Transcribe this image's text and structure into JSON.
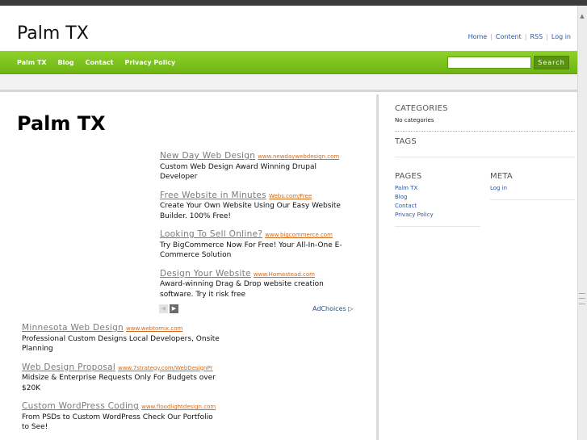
{
  "site": {
    "title": "Palm TX"
  },
  "toplinks": [
    "Home",
    "Content",
    "RSS",
    "Log in"
  ],
  "nav": [
    "Palm TX",
    "Blog",
    "Contact",
    "Privacy Policy"
  ],
  "search": {
    "button_label": "Search",
    "placeholder": ""
  },
  "page": {
    "title": "Palm TX"
  },
  "ads_primary": [
    {
      "title": "New Day Web Design",
      "url": "www.newdaywebdesign.com",
      "desc": "Custom Web Design Award Winning Drupal Developer"
    },
    {
      "title": "Free Website in Minutes",
      "url": "Webs.com/Free",
      "desc": "Create Your Own Website Using Our Easy Website Builder. 100% Free!"
    },
    {
      "title": "Looking To Sell Online?",
      "url": "www.bigcommerce.com",
      "desc": "Try BigCommerce Now For Free! Your All-In-One E-Commerce Solution"
    },
    {
      "title": "Design Your Website",
      "url": "www.Homestead.com",
      "desc": "Award-winning Drag & Drop website creation software. Try it risk free"
    }
  ],
  "adchoices_label": "AdChoices",
  "ads_secondary": [
    {
      "title": "Minnesota Web Design",
      "url": "www.webtomix.com",
      "desc": "Professional Custom Designs Local Developers, Onsite Planning"
    },
    {
      "title": "Web Design Proposal",
      "url": "www.7strategy.com/WebDesignPr",
      "desc": "Midsize & Enterprise Requests Only For Budgets over $20K"
    },
    {
      "title": "Custom WordPress Coding",
      "url": "www.floodlightdesign.com",
      "desc": "From PSDs to Custom WordPress Check Our Portfolio to See!"
    }
  ],
  "sidebar": {
    "categories": {
      "heading": "CATEGORIES",
      "empty_text": "No categories"
    },
    "tags": {
      "heading": "TAGS"
    },
    "pages": {
      "heading": "PAGES",
      "items": [
        "Palm TX",
        "Blog",
        "Contact",
        "Privacy Policy"
      ]
    },
    "meta": {
      "heading": "META",
      "items": [
        "Log in"
      ]
    }
  },
  "colors": {
    "nav_green": "#7fc31f",
    "link_blue": "#2a59a5",
    "ad_url_orange": "#d46a1b"
  }
}
